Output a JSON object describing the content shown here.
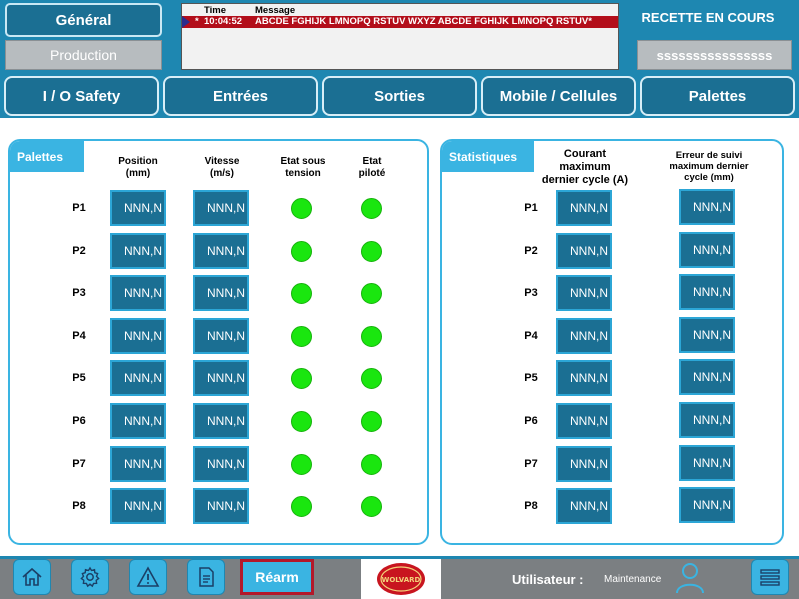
{
  "header": {
    "general_label": "Général",
    "production_label": "Production",
    "recette_title": "RECETTE EN COURS",
    "recette_value": "ssssssssssssssss",
    "alarm": {
      "col_time": "Time",
      "col_message": "Message",
      "row_marker": "*",
      "row_time": "10:04:52",
      "row_message": "ABCDE FGHIJK LMNOPQ RSTUV WXYZ ABCDE FGHIJK LMNOPQ RSTUV*",
      "row_color": "#b30e1a"
    }
  },
  "nav": {
    "tabs": [
      {
        "label": "I / O Safety"
      },
      {
        "label": "Entrées"
      },
      {
        "label": "Sorties"
      },
      {
        "label": "Mobile / Cellules"
      },
      {
        "label": "Palettes"
      }
    ]
  },
  "palettes_panel": {
    "title": "Palettes",
    "columns": [
      "Position\n(mm)",
      "Vitesse\n(m/s)",
      "Etat sous\ntension",
      "Etat\npiloté"
    ],
    "rows": [
      {
        "label": "P1",
        "position": "NNN,N",
        "vitesse": "NNN,N",
        "etat_tension": "on",
        "etat_pilote": "on"
      },
      {
        "label": "P2",
        "position": "NNN,N",
        "vitesse": "NNN,N",
        "etat_tension": "on",
        "etat_pilote": "on"
      },
      {
        "label": "P3",
        "position": "NNN,N",
        "vitesse": "NNN,N",
        "etat_tension": "on",
        "etat_pilote": "on"
      },
      {
        "label": "P4",
        "position": "NNN,N",
        "vitesse": "NNN,N",
        "etat_tension": "on",
        "etat_pilote": "on"
      },
      {
        "label": "P5",
        "position": "NNN,N",
        "vitesse": "NNN,N",
        "etat_tension": "on",
        "etat_pilote": "on"
      },
      {
        "label": "P6",
        "position": "NNN,N",
        "vitesse": "NNN,N",
        "etat_tension": "on",
        "etat_pilote": "on"
      },
      {
        "label": "P7",
        "position": "NNN,N",
        "vitesse": "NNN,N",
        "etat_tension": "on",
        "etat_pilote": "on"
      },
      {
        "label": "P8",
        "position": "NNN,N",
        "vitesse": "NNN,N",
        "etat_tension": "on",
        "etat_pilote": "on"
      }
    ]
  },
  "stats_panel": {
    "title": "Statistiques",
    "columns": [
      "Courant\nmaximum\ndernier cycle (A)",
      "Erreur de suivi\nmaximum dernier\ncycle (mm)"
    ],
    "rows": [
      {
        "label": "P1",
        "courant": "NNN,N",
        "erreur": "NNN,N"
      },
      {
        "label": "P2",
        "courant": "NNN,N",
        "erreur": "NNN,N"
      },
      {
        "label": "P3",
        "courant": "NNN,N",
        "erreur": "NNN,N"
      },
      {
        "label": "P4",
        "courant": "NNN,N",
        "erreur": "NNN,N"
      },
      {
        "label": "P5",
        "courant": "NNN,N",
        "erreur": "NNN,N"
      },
      {
        "label": "P6",
        "courant": "NNN,N",
        "erreur": "NNN,N"
      },
      {
        "label": "P7",
        "courant": "NNN,N",
        "erreur": "NNN,N"
      },
      {
        "label": "P8",
        "courant": "NNN,N",
        "erreur": "NNN,N"
      }
    ]
  },
  "footer": {
    "icons": [
      "home-icon",
      "gear-icon",
      "warning-icon",
      "document-icon"
    ],
    "rearm_label": "Réarm",
    "logo_text": "WOLVARD",
    "user_label": "Utilisateur :",
    "user_value": "Maintenance",
    "user_icon": "user-icon",
    "menu_icon": "menu-icon"
  },
  "colors": {
    "primary": "#1e87b1",
    "button_dark": "#1b6f93",
    "accent_light": "#3ab4e2",
    "led_on": "#1ae60f",
    "alarm_red": "#b30e1a"
  }
}
